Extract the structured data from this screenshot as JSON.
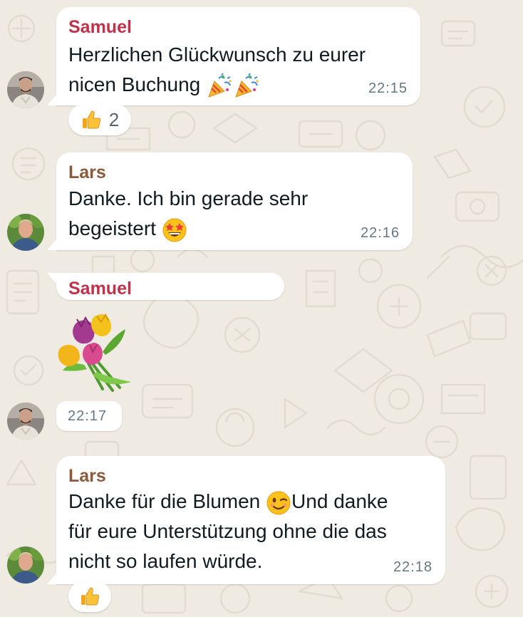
{
  "colors": {
    "background": "#efeae2",
    "bubble": "#ffffff",
    "sender_samuel": "#c1324a",
    "sender_lars": "#8a5a3a",
    "timestamp": "#667781"
  },
  "messages": [
    {
      "sender": "Samuel",
      "lines": [
        "Herzlichen Glückwunsch zu eurer",
        "nicen Buchung"
      ],
      "emojis": [
        "party-popper-icon",
        "party-popper-icon"
      ],
      "time": "22:15",
      "reaction": {
        "icon": "thumbs-up-icon",
        "count": "2"
      }
    },
    {
      "sender": "Lars",
      "lines": [
        "Danke. Ich bin gerade sehr",
        "begeistert"
      ],
      "emojis": [
        "star-struck-icon"
      ],
      "time": "22:16"
    },
    {
      "sender": "Samuel",
      "sticker": "tulip-bouquet-icon",
      "time": "22:17"
    },
    {
      "sender": "Lars",
      "lines": [
        "Danke für die Blumen",
        "Und danke",
        "für eure Unterstützung ohne die das",
        "nicht so laufen würde."
      ],
      "emojis": [
        "winking-face-icon"
      ],
      "time": "22:18",
      "reaction": {
        "icon": "thumbs-up-icon"
      }
    }
  ]
}
